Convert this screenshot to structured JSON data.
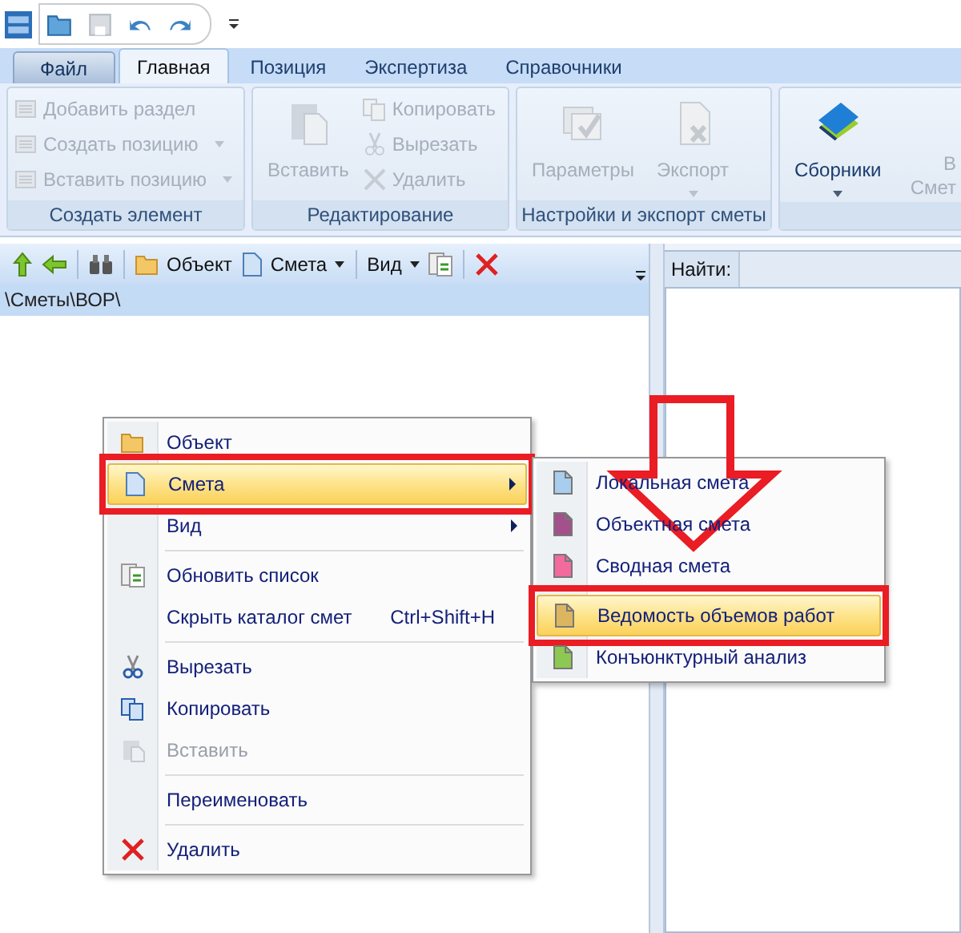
{
  "tabs": [
    {
      "label": "Файл",
      "selected": false,
      "kind": "file"
    },
    {
      "label": "Главная",
      "selected": true,
      "kind": "tab"
    },
    {
      "label": "Позиция",
      "selected": false,
      "kind": "tab"
    },
    {
      "label": "Экспертиза",
      "selected": false,
      "kind": "tab"
    },
    {
      "label": "Справочники",
      "selected": false,
      "kind": "tab"
    }
  ],
  "ribbon_groups": [
    {
      "title": "Создать элемент",
      "items": [
        {
          "kind": "small",
          "label": "Добавить раздел",
          "disabled": true,
          "dropdown": false
        },
        {
          "kind": "small",
          "label": "Создать позицию",
          "disabled": true,
          "dropdown": true
        },
        {
          "kind": "small",
          "label": "Вставить позицию",
          "disabled": true,
          "dropdown": true
        }
      ]
    },
    {
      "title": "Редактирование",
      "items": [
        {
          "kind": "large",
          "label": "Вставить",
          "disabled": true,
          "dropdown": false
        },
        {
          "kind": "small",
          "label": "Копировать",
          "disabled": true,
          "dropdown": false
        },
        {
          "kind": "small",
          "label": "Вырезать",
          "disabled": true,
          "dropdown": false
        },
        {
          "kind": "small",
          "label": "Удалить",
          "disabled": true,
          "dropdown": false
        }
      ]
    },
    {
      "title": "Настройки и экспорт сметы",
      "items": [
        {
          "kind": "large",
          "label": "Параметры",
          "disabled": true,
          "dropdown": false
        },
        {
          "kind": "large",
          "label": "Экспорт",
          "disabled": true,
          "dropdown": true
        }
      ]
    },
    {
      "items": [
        {
          "kind": "large",
          "label": "Сборники",
          "disabled": false,
          "dropdown": true
        },
        {
          "kind": "cut",
          "label": "В",
          "label_2": "Смет",
          "disabled": true
        }
      ]
    }
  ],
  "toolbar": {
    "object": "Объект",
    "estimate": "Смета",
    "view": "Вид"
  },
  "path": "\\Сметы\\ВОР\\",
  "search_label": "Найти:",
  "context_menu": {
    "items": [
      {
        "label": "Объект",
        "selected": false,
        "disabled": false,
        "separator_before": false
      },
      {
        "label": "Смета",
        "selected": true,
        "disabled": false,
        "separator_before": false,
        "submenu": true
      },
      {
        "label": "Вид",
        "selected": false,
        "disabled": false,
        "separator_before": false,
        "submenu": true
      },
      {
        "label": "Обновить список",
        "selected": false,
        "disabled": false,
        "separator_before": true
      },
      {
        "label": "Скрыть каталог смет",
        "shortcut": "Ctrl+Shift+H",
        "selected": false,
        "disabled": false,
        "separator_before": false
      },
      {
        "label": "Вырезать",
        "selected": false,
        "disabled": false,
        "separator_before": true
      },
      {
        "label": "Копировать",
        "selected": false,
        "disabled": false,
        "separator_before": false
      },
      {
        "label": "Вставить",
        "selected": false,
        "disabled": true,
        "separator_before": false
      },
      {
        "label": "Переименовать",
        "selected": false,
        "disabled": false,
        "separator_before": true
      },
      {
        "label": "Удалить",
        "selected": false,
        "disabled": false,
        "separator_before": true
      }
    ]
  },
  "submenu": {
    "items": [
      {
        "label": "Локальная смета",
        "color": "#a9cdee",
        "selected": false,
        "separator_before": false
      },
      {
        "label": "Объектная смета",
        "color": "#a4508c",
        "selected": false,
        "separator_before": false
      },
      {
        "label": "Сводная смета",
        "color": "#f26b9c",
        "selected": false,
        "separator_before": false
      },
      {
        "label": "Ведомость объемов работ",
        "color": "#dcb560",
        "selected": true,
        "separator_before": true
      },
      {
        "label": "Конъюнктурный анализ",
        "color": "#8dc852",
        "selected": false,
        "separator_before": false
      }
    ]
  }
}
